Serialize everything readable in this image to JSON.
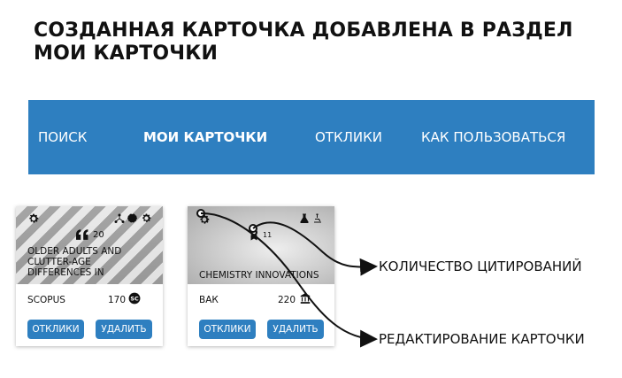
{
  "headline": {
    "line1": "СОЗДАННАЯ КАРТОЧКА ДОБАВЛЕНА В РАЗДЕЛ",
    "line2": "МОИ КАРТОЧКИ"
  },
  "nav": {
    "items": [
      {
        "label": "ПОИСК",
        "active": false
      },
      {
        "label": "МОИ КАРТОЧКИ",
        "active": true
      },
      {
        "label": "ОТКЛИКИ",
        "active": false
      },
      {
        "label": "КАК ПОЛЬЗОВАТЬСЯ",
        "active": false
      }
    ],
    "background": "#2e7fc0"
  },
  "cards": [
    {
      "title": "OLDER ADULTS AND CLUTTER-AGE DIFFERENCES IN CLUTTER...",
      "citations": "20",
      "source": "SCOPUS",
      "source_value": "170",
      "responses_button": "ОТКЛИКИ",
      "delete_button": "УДАЛИТЬ",
      "icons": [
        "gear-icon",
        "quote-icon",
        "network-icon",
        "brain-icon",
        "gear-icon"
      ]
    },
    {
      "title": "CHEMISTRY INNOVATIONS",
      "citations": "11",
      "source": "ВАК",
      "source_value": "220",
      "responses_button": "ОТКЛИКИ",
      "delete_button": "УДАЛИТЬ",
      "icons": [
        "gear-icon",
        "award-icon",
        "flask-icon",
        "microscope-icon"
      ]
    }
  ],
  "annotations": {
    "citations": "КОЛИЧЕСТВО ЦИТИРОВАНИЙ",
    "edit": "РЕДАКТИРОВАНИЕ КАРТОЧКИ"
  },
  "colors": {
    "accent": "#2e7fc0",
    "text": "#111111"
  }
}
